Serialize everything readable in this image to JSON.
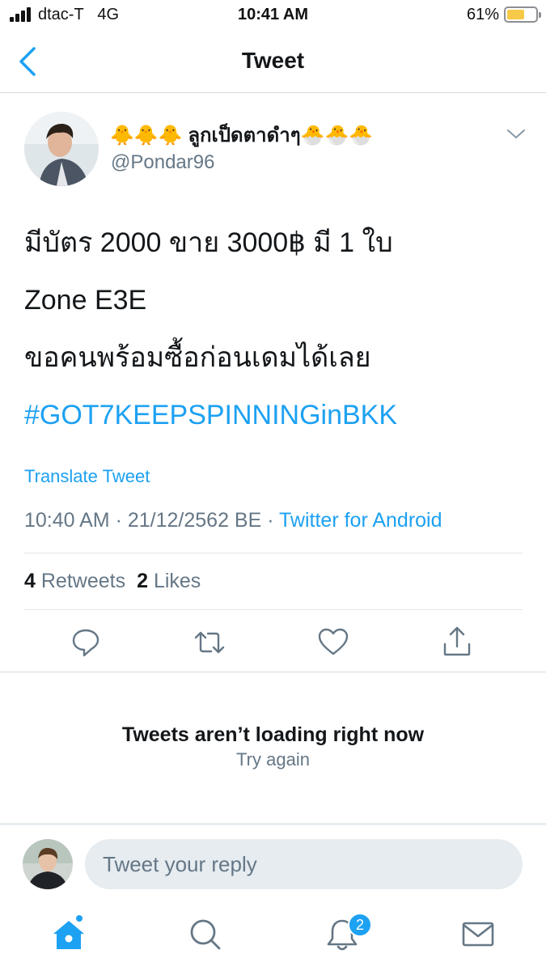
{
  "status_bar": {
    "carrier": "dtac-T",
    "network": "4G",
    "time": "10:41 AM",
    "battery_percent": "61%",
    "battery_level": 0.61,
    "signal_bars": 4
  },
  "nav": {
    "title": "Tweet",
    "back_icon": "chevron-left-icon"
  },
  "tweet": {
    "display_name": "🐥🐥🐥 ลูกเป็ดตาดำๆ🐣🐣🐣",
    "handle": "@Pondar96",
    "lines": [
      "มีบัตร 2000 ขาย 3000฿ มี 1 ใบ",
      "Zone E3E",
      "ขอคนพร้อมซื้อก่อนเดมได้เลย"
    ],
    "hashtag": "#GOT7KEEPSPINNINGinBKK",
    "translate_label": "Translate Tweet",
    "timestamp": "10:40 AM · 21/12/2562 BE · ",
    "source": "Twitter for Android",
    "retweets_count": "4",
    "retweets_label": "Retweets",
    "likes_count": "2",
    "likes_label": "Likes"
  },
  "actions": [
    "reply-icon",
    "retweet-icon",
    "like-icon",
    "share-icon"
  ],
  "replies": {
    "error_title": "Tweets aren’t loading right now",
    "retry_label": "Try again"
  },
  "reply_bar": {
    "placeholder": "Tweet your reply"
  },
  "tab_bar": {
    "tabs": [
      "home-icon",
      "search-icon",
      "notifications-icon",
      "messages-icon"
    ],
    "notifications_badge": "2"
  },
  "colors": {
    "accent": "#1da1f2",
    "secondary_text": "#657786",
    "primary_text": "#14171a",
    "battery": "#f7c948"
  }
}
